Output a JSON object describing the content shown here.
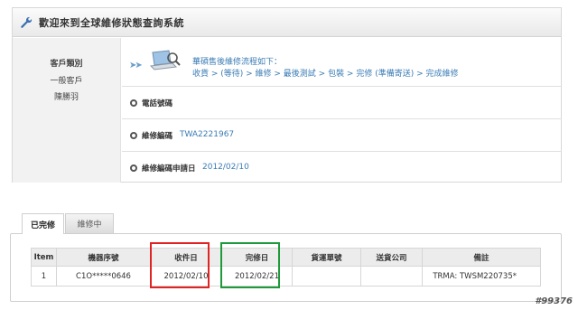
{
  "header": {
    "title": "歡迎來到全球維修狀態查詢系統",
    "icon": "wrench-icon"
  },
  "customer": {
    "type_label": "客戶類別",
    "type_value": "一般客戶",
    "name": "陳勝羽"
  },
  "flow": {
    "arrows": "➤➤",
    "title": "華碩售後維修流程如下：",
    "steps": "收貨 > (等待) > 維修 > 最後測試 > 包裝 > 完修 (準備寄送) > 完成維修"
  },
  "fields": {
    "phone_label": "電話號碼",
    "phone_value": "",
    "repair_no_label": "維修編碼",
    "repair_no_value": "TWA2221967",
    "apply_date_label": "維修編碼申請日",
    "apply_date_value": "2012/02/10"
  },
  "tabs": [
    {
      "label": "已完修"
    },
    {
      "label": "維修中"
    }
  ],
  "table": {
    "headers": [
      "Item",
      "機器序號",
      "收件日",
      "完修日",
      "貨運單號",
      "送貨公司",
      "備註"
    ],
    "rows": [
      [
        "1",
        "C1O*****0646",
        "2012/02/10",
        "2012/02/21",
        "",
        "",
        "TRMA: TWSM220735*"
      ]
    ]
  },
  "watermark": "#99376",
  "colors": {
    "link": "#3a7cb5",
    "highlight_red": "#e02424",
    "highlight_green": "#1f9a3a"
  }
}
